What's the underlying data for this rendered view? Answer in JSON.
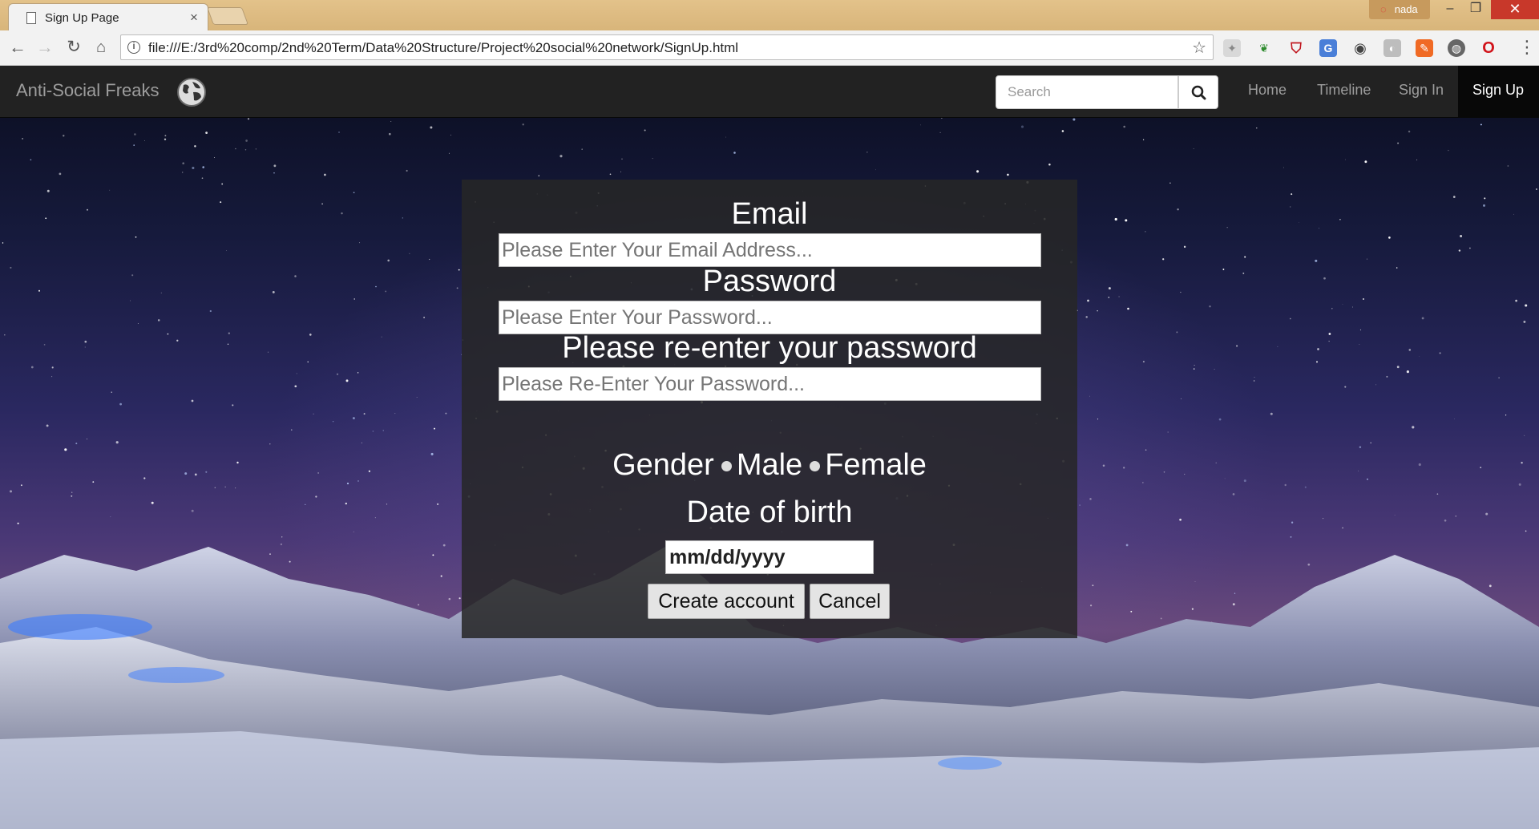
{
  "browser": {
    "tab_title": "Sign Up Page",
    "tab_close": "×",
    "user_name": "nada",
    "url": "file:///E:/3rd%20comp/2nd%20Term/Data%20Structure/Project%20social%20network/SignUp.html",
    "window_minimize": "–",
    "window_maximize": "❐",
    "window_close": "✕",
    "extensions": [
      "translate-icon",
      "ublock-icon",
      "google-translate-icon",
      "eye-icon",
      "grayscale-icon",
      "paint-icon",
      "globe-ext-icon",
      "opera-icon"
    ]
  },
  "site": {
    "brand": "Anti-Social Freaks",
    "search_placeholder": "Search",
    "nav": {
      "home": "Home",
      "timeline": "Timeline",
      "signin": "Sign In",
      "signup": "Sign Up"
    }
  },
  "form": {
    "email_label": "Email",
    "email_placeholder": "Please Enter Your Email Address...",
    "password_label": "Password",
    "password_placeholder": "Please Enter Your Password...",
    "reenter_label": "Please re-enter your password",
    "reenter_placeholder": "Please Re-Enter Your Password...",
    "gender_label": "Gender",
    "male_label": "Male",
    "female_label": "Female",
    "dob_label": "Date of birth",
    "dob_placeholder": "mm/dd/yyyy",
    "create_button": "Create account",
    "cancel_button": "Cancel"
  },
  "colors": {
    "navbar_bg": "#222222",
    "navbar_active_bg": "#080808",
    "panel_bg": "rgba(38,38,38,0.86)",
    "titlebar": "#d8b57a",
    "close_button": "#c8382a"
  }
}
